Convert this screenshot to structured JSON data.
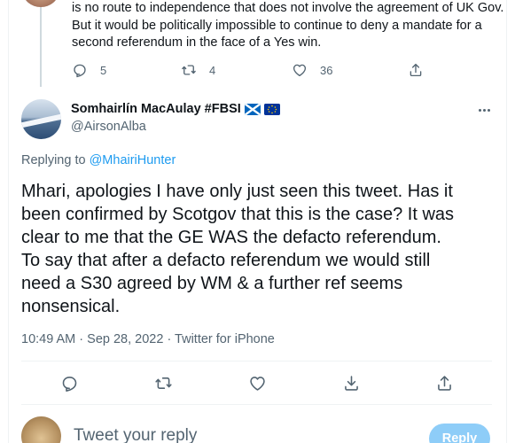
{
  "parent_tweet": {
    "text_lines": [
      "is no route to independence that does not involve the agreement of UK Gov.",
      "But it would be politically impossible to continue to deny a mandate for a",
      "second referendum in the face of a Yes win."
    ],
    "reply_count": "5",
    "retweet_count": "4",
    "like_count": "36"
  },
  "tweet": {
    "display_name": "Somhairlín MacAulay #FBSI",
    "handle": "@AirsonAlba",
    "replying_prefix": "Replying to",
    "replying_to": "@MhairiHunter",
    "text_lines": [
      "Mhari, apologies I have only just seen this tweet. Has it",
      "been confirmed by Scotgov that this is the case? It was",
      "clear to me that the GE WAS the defacto referendum.",
      "To say that after a defacto referendum we would still",
      "need a S30 agreed by WM & a further ref seems",
      "nonsensical."
    ],
    "meta": "10:49 AM · Sep 28, 2022 · Twitter for iPhone"
  },
  "reply_box": {
    "placeholder": "Tweet your reply",
    "button_label": "Reply"
  },
  "colors": {
    "accent": "#1d9bf0",
    "secondary_text": "#536471",
    "reply_button_disabled": "#8ecdf8"
  }
}
